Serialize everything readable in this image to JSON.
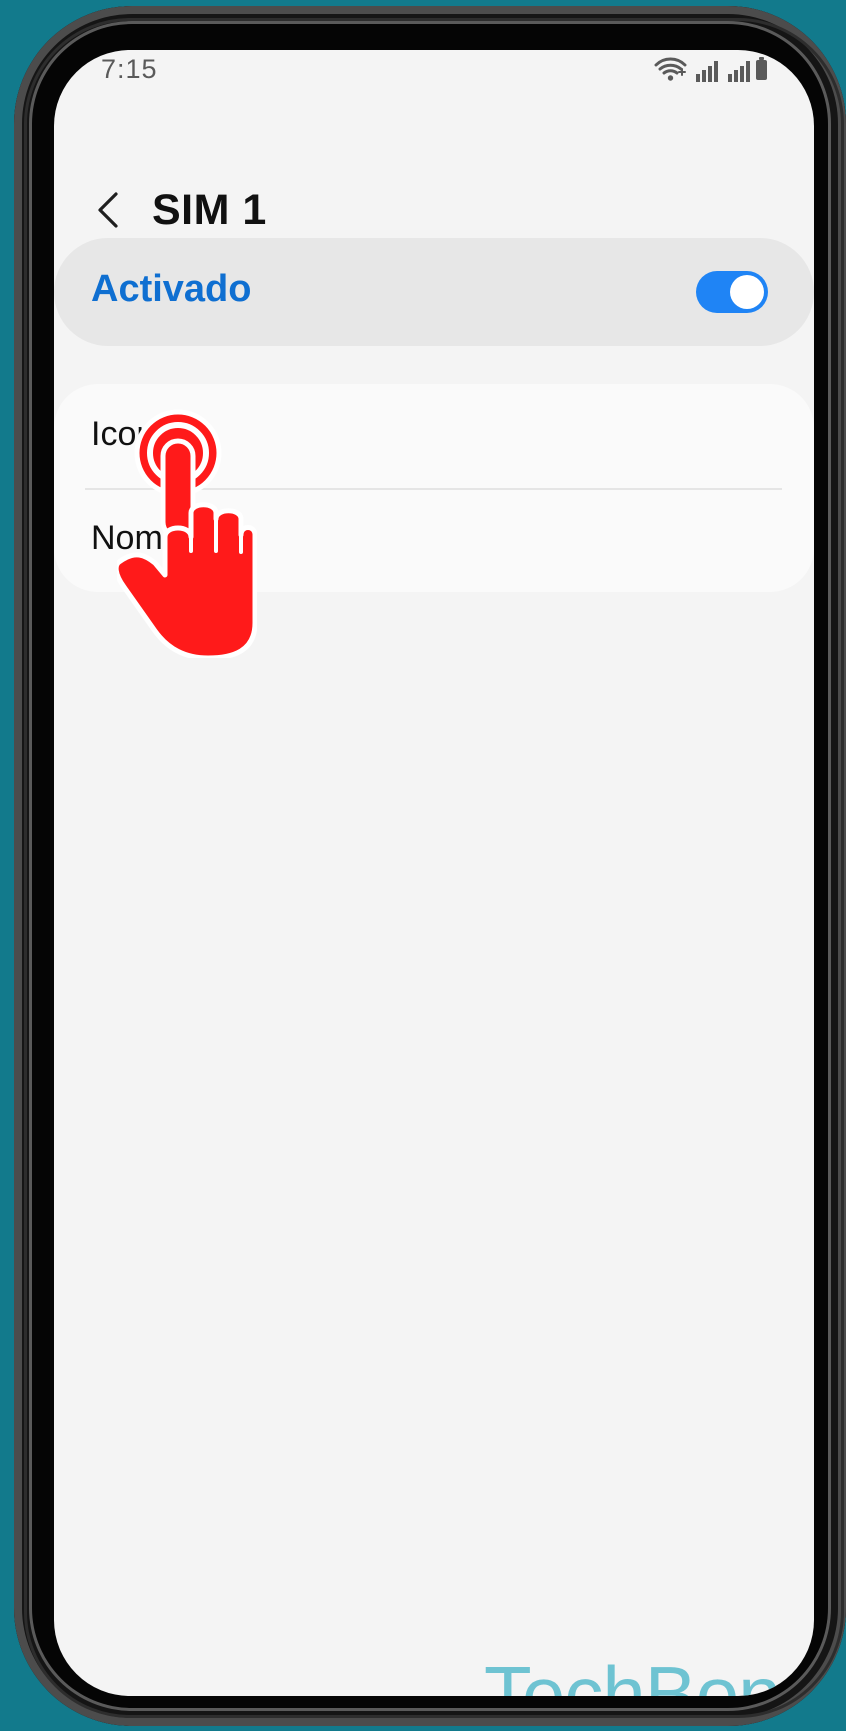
{
  "status_bar": {
    "time": "7:15",
    "icons": [
      "wifi-icon",
      "signal-icon",
      "signal-icon",
      "battery-icon"
    ]
  },
  "header": {
    "title": "SIM 1",
    "back_icon": "back-arrow-icon"
  },
  "activation": {
    "label": "Activado",
    "enabled": true
  },
  "settings": {
    "items": [
      {
        "label": "Icono"
      },
      {
        "label": "Nombre"
      }
    ]
  },
  "overlay": {
    "gesture_icon": "tap-gesture-icon"
  },
  "watermark": {
    "text": "TechBone"
  },
  "colors": {
    "accent": "#0f6fd1",
    "toggle_on": "#1f84f5",
    "background": "#127a8c",
    "gesture": "#ff1a1a",
    "watermark": "#6ec3d2"
  }
}
